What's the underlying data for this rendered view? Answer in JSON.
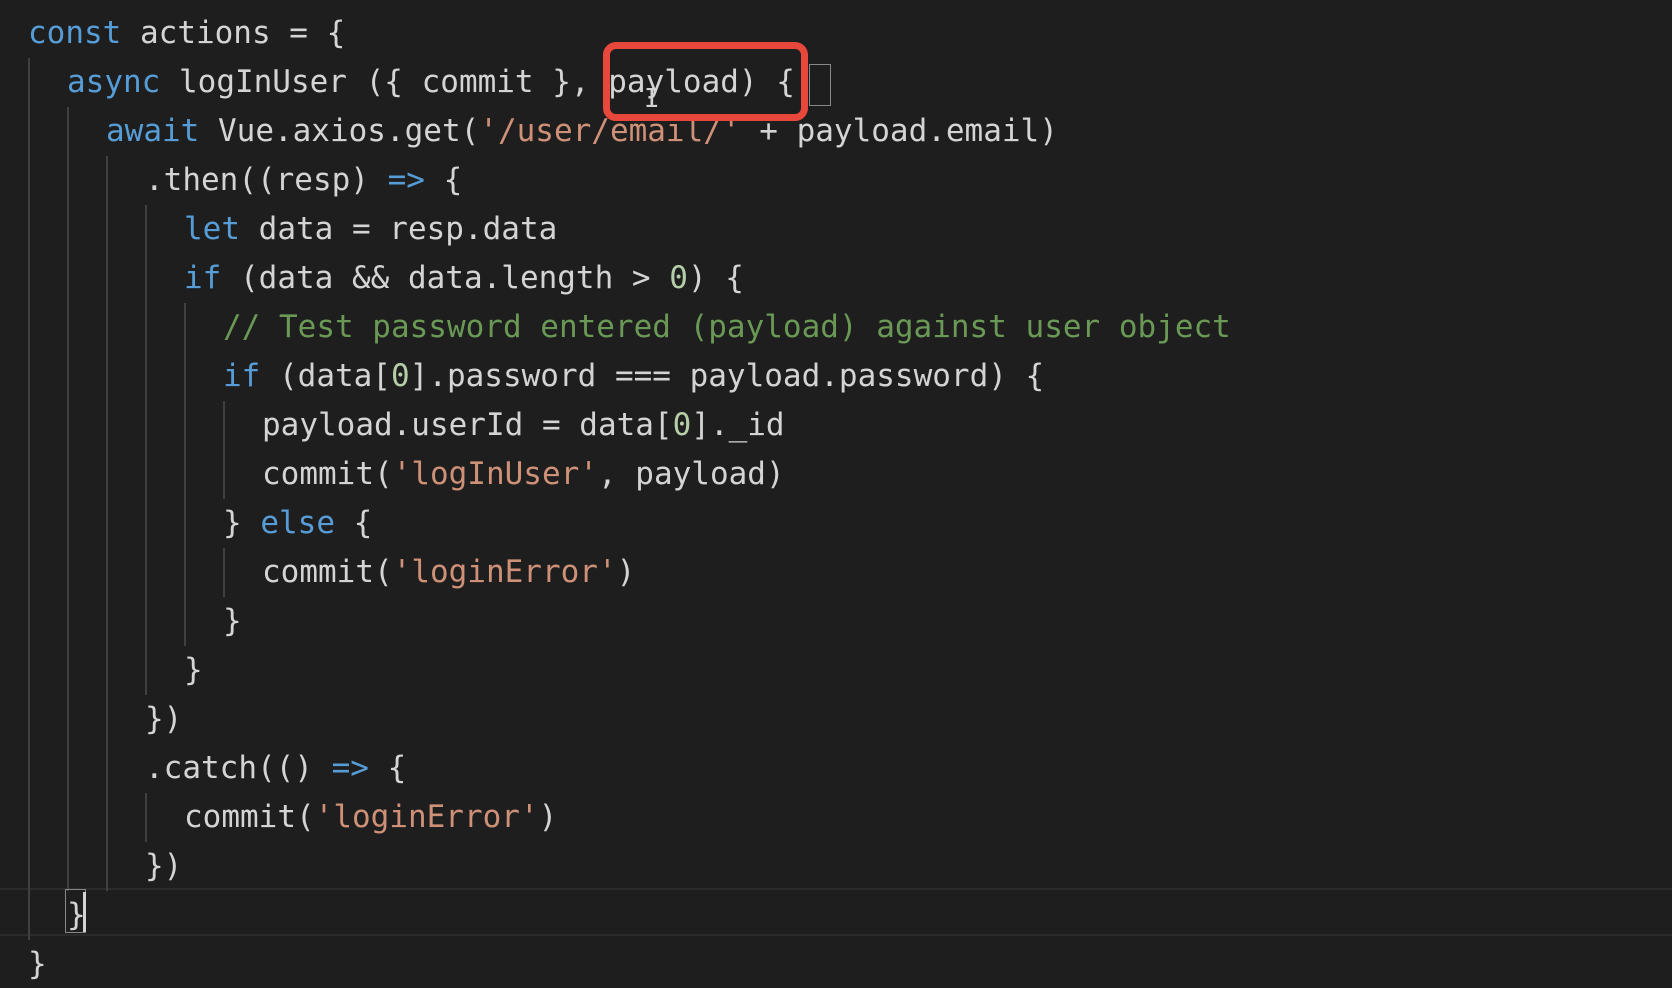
{
  "code_lines": [
    {
      "indent": 0,
      "tokens": [
        {
          "t": "const",
          "c": "kw"
        },
        {
          "t": " actions = {",
          "c": "tx"
        }
      ]
    },
    {
      "indent": 1,
      "tokens": [
        {
          "t": "async",
          "c": "kw"
        },
        {
          "t": " logInUser ({ commit }, payload) {",
          "c": "tx"
        }
      ]
    },
    {
      "indent": 2,
      "tokens": [
        {
          "t": "await",
          "c": "kw"
        },
        {
          "t": " Vue.axios.get(",
          "c": "tx"
        },
        {
          "t": "'/user/email/'",
          "c": "st"
        },
        {
          "t": " + payload.email)",
          "c": "tx"
        }
      ]
    },
    {
      "indent": 3,
      "tokens": [
        {
          "t": ".then((resp) ",
          "c": "tx"
        },
        {
          "t": "=>",
          "c": "kw"
        },
        {
          "t": " {",
          "c": "tx"
        }
      ]
    },
    {
      "indent": 4,
      "tokens": [
        {
          "t": "let",
          "c": "kw"
        },
        {
          "t": " data = resp.data",
          "c": "tx"
        }
      ]
    },
    {
      "indent": 4,
      "tokens": [
        {
          "t": "if",
          "c": "kw"
        },
        {
          "t": " (data && data.length > ",
          "c": "tx"
        },
        {
          "t": "0",
          "c": "nm"
        },
        {
          "t": ") {",
          "c": "tx"
        }
      ]
    },
    {
      "indent": 5,
      "tokens": [
        {
          "t": "// Test password entered (payload) against user object",
          "c": "cm"
        }
      ]
    },
    {
      "indent": 5,
      "tokens": [
        {
          "t": "if",
          "c": "kw"
        },
        {
          "t": " (data[",
          "c": "tx"
        },
        {
          "t": "0",
          "c": "nm"
        },
        {
          "t": "].password === payload.password) {",
          "c": "tx"
        }
      ]
    },
    {
      "indent": 6,
      "tokens": [
        {
          "t": "payload.userId = data[",
          "c": "tx"
        },
        {
          "t": "0",
          "c": "nm"
        },
        {
          "t": "]._id",
          "c": "tx"
        }
      ]
    },
    {
      "indent": 6,
      "tokens": [
        {
          "t": "commit(",
          "c": "tx"
        },
        {
          "t": "'logInUser'",
          "c": "st"
        },
        {
          "t": ", payload)",
          "c": "tx"
        }
      ]
    },
    {
      "indent": 5,
      "tokens": [
        {
          "t": "} ",
          "c": "tx"
        },
        {
          "t": "else",
          "c": "kw"
        },
        {
          "t": " {",
          "c": "tx"
        }
      ]
    },
    {
      "indent": 6,
      "tokens": [
        {
          "t": "commit(",
          "c": "tx"
        },
        {
          "t": "'loginError'",
          "c": "st"
        },
        {
          "t": ")",
          "c": "tx"
        }
      ]
    },
    {
      "indent": 5,
      "tokens": [
        {
          "t": "}",
          "c": "tx"
        }
      ]
    },
    {
      "indent": 4,
      "tokens": [
        {
          "t": "}",
          "c": "tx"
        }
      ]
    },
    {
      "indent": 3,
      "tokens": [
        {
          "t": "})",
          "c": "tx"
        }
      ]
    },
    {
      "indent": 3,
      "tokens": [
        {
          "t": ".catch(() ",
          "c": "tx"
        },
        {
          "t": "=>",
          "c": "kw"
        },
        {
          "t": " {",
          "c": "tx"
        }
      ]
    },
    {
      "indent": 4,
      "tokens": [
        {
          "t": "commit(",
          "c": "tx"
        },
        {
          "t": "'loginError'",
          "c": "st"
        },
        {
          "t": ")",
          "c": "tx"
        }
      ]
    },
    {
      "indent": 3,
      "tokens": [
        {
          "t": "})",
          "c": "tx"
        }
      ]
    },
    {
      "indent": 1,
      "tokens": [
        {
          "t": "}",
          "c": "tx"
        }
      ]
    },
    {
      "indent": 0,
      "tokens": [
        {
          "t": "}",
          "c": "tx"
        }
      ]
    }
  ],
  "colors": {
    "background": "#1e1e1e",
    "keyword": "#569cd6",
    "text": "#d4d4d4",
    "string": "#ce9178",
    "comment": "#6a9955",
    "number": "#b5cea8",
    "annotation_box": "#e8473c"
  }
}
